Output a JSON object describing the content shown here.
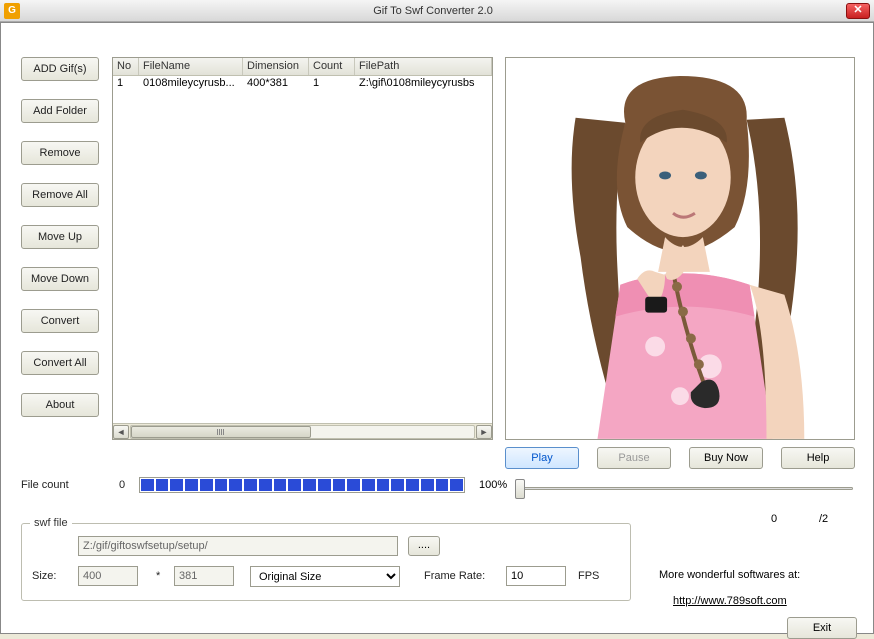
{
  "titlebar": {
    "icon_letter": "G",
    "title": "Gif To Swf Converter 2.0",
    "close": "✕"
  },
  "sidebar": {
    "add_gif": "ADD Gif(s)",
    "add_folder": "Add Folder",
    "remove": "Remove",
    "remove_all": "Remove All",
    "move_up": "Move Up",
    "move_down": "Move Down",
    "convert": "Convert",
    "convert_all": "Convert All",
    "about": "About"
  },
  "table": {
    "headers": {
      "no": "No",
      "filename": "FileName",
      "dimension": "Dimension",
      "count": "Count",
      "filepath": "FilePath"
    },
    "rows": [
      {
        "no": "1",
        "filename": "0108mileycyrusb...",
        "dimension": "400*381",
        "count": "1",
        "filepath": "Z:\\gif\\0108mileycyrusbs"
      }
    ]
  },
  "preview_buttons": {
    "play": "Play",
    "pause": "Pause",
    "buy_now": "Buy Now",
    "help": "Help"
  },
  "file_count": {
    "label": "File count",
    "value": "0"
  },
  "progress": {
    "percent_label": "100%",
    "segments": 22
  },
  "slider": {
    "current": "0",
    "max": "/2"
  },
  "swf": {
    "legend": "swf file",
    "path": "Z:/gif/giftoswfsetup/setup/",
    "browse": "....",
    "size_label": "Size:",
    "width": "400",
    "times": "*",
    "height": "381",
    "mode": "Original Size",
    "frame_rate_label": "Frame Rate:",
    "frame_rate": "10",
    "fps": "FPS"
  },
  "footer": {
    "more_label": "More wonderful softwares at:",
    "link": "http://www.789soft.com",
    "exit": "Exit"
  }
}
